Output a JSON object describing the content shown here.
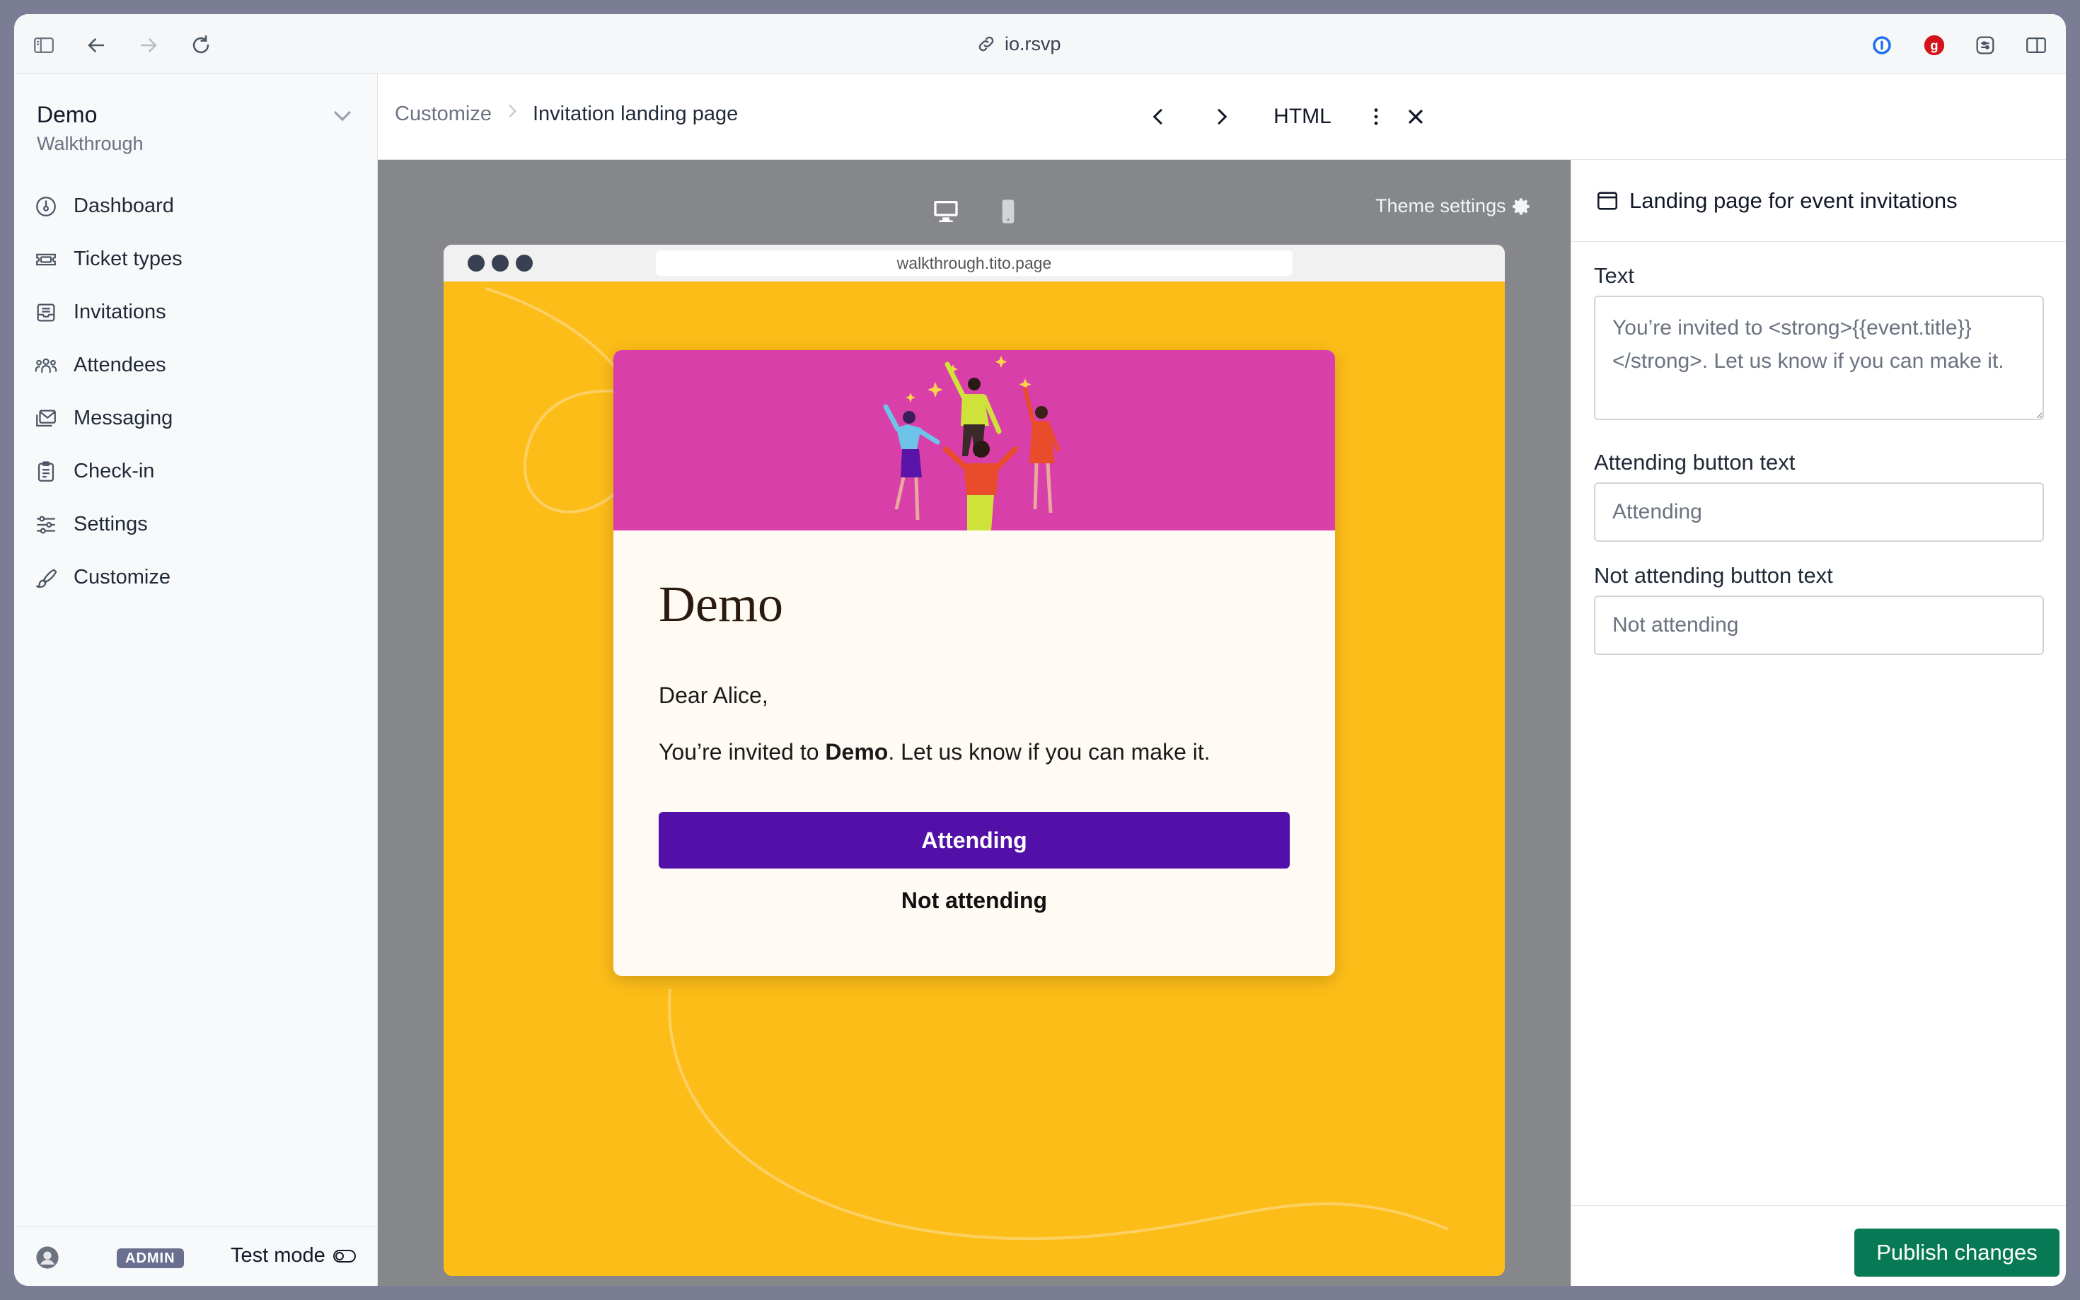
{
  "browser": {
    "url": "io.rsvp",
    "icons": [
      "sidebar-toggle-icon",
      "back-icon",
      "forward-icon",
      "reload-icon",
      "link-icon",
      "password-manager-icon",
      "grammar-extension-icon",
      "extension-icon",
      "split-view-icon"
    ]
  },
  "sidebar": {
    "org_name": "Demo",
    "org_subtitle": "Walkthrough",
    "items": [
      {
        "label": "Dashboard",
        "icon": "dashboard-icon"
      },
      {
        "label": "Ticket types",
        "icon": "ticket-icon"
      },
      {
        "label": "Invitations",
        "icon": "inbox-icon"
      },
      {
        "label": "Attendees",
        "icon": "people-icon"
      },
      {
        "label": "Messaging",
        "icon": "mail-icon"
      },
      {
        "label": "Check-in",
        "icon": "clipboard-icon"
      },
      {
        "label": "Settings",
        "icon": "sliders-icon"
      },
      {
        "label": "Customize",
        "icon": "brush-icon"
      }
    ],
    "footer": {
      "badge": "ADMIN",
      "test_mode": "Test mode"
    }
  },
  "header": {
    "breadcrumb_parent": "Customize",
    "breadcrumb_current": "Invitation landing page",
    "format_label": "HTML"
  },
  "preview": {
    "theme_settings": "Theme settings",
    "mock_url": "walkthrough.tito.page",
    "card": {
      "title": "Demo",
      "greeting": "Dear Alice,",
      "message_before": "You’re invited to ",
      "message_bold": "Demo",
      "message_after": ". Let us know if you can make it.",
      "attending_button": "Attending",
      "not_attending_button": "Not attending"
    },
    "colors": {
      "page_background": "#fdbd18",
      "hero_background": "#d93fa8",
      "attending_button": "#5210a9",
      "card_background": "#fffbf4"
    }
  },
  "panel": {
    "title": "Landing page for event invitations",
    "text_label": "Text",
    "text_value": "You’re invited to <strong>{{event.title}}</strong>. Let us know if you can make it.",
    "attending_label": "Attending button text",
    "attending_placeholder": "Attending",
    "not_attending_label": "Not attending button text",
    "not_attending_placeholder": "Not attending",
    "publish_button": "Publish changes",
    "publish_color": "#077a55"
  }
}
